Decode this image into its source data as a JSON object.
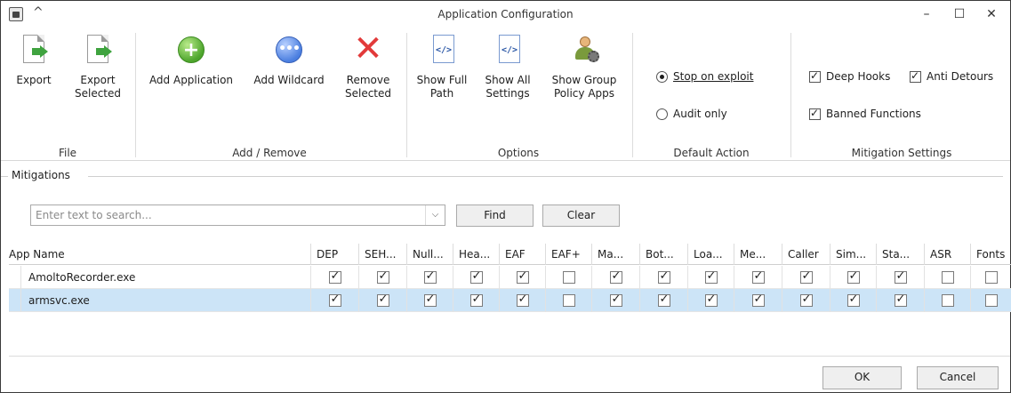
{
  "window": {
    "title": "Application Configuration",
    "collapse": "^",
    "minimize": "–",
    "maximize": "☐",
    "close": "✕"
  },
  "ribbon": {
    "file": {
      "label": "File",
      "export": "Export",
      "export_selected": "Export\nSelected"
    },
    "add_remove": {
      "label": "Add / Remove",
      "add_application": "Add Application",
      "add_wildcard": "Add Wildcard",
      "remove_selected": "Remove\nSelected"
    },
    "options": {
      "label": "Options",
      "show_full_path": "Show Full\nPath",
      "show_all_settings": "Show All\nSettings",
      "show_group_policy_apps": "Show Group\nPolicy Apps",
      "code_glyph": "</>"
    },
    "default_action": {
      "label": "Default Action",
      "stop_on_exploit": "Stop on exploit",
      "audit_only": "Audit only",
      "selected": "stop_on_exploit"
    },
    "mitigation_settings": {
      "label": "Mitigation Settings",
      "deep_hooks": "Deep Hooks",
      "anti_detours": "Anti Detours",
      "banned_functions": "Banned Functions",
      "deep_hooks_checked": true,
      "anti_detours_checked": true,
      "banned_functions_checked": true
    }
  },
  "mitigations": {
    "legend": "Mitigations",
    "search_placeholder": "Enter text to search...",
    "find_label": "Find",
    "clear_label": "Clear"
  },
  "grid": {
    "app_name_header": "App Name",
    "columns": [
      "DEP",
      "SEH...",
      "Null...",
      "Hea...",
      "EAF",
      "EAF+",
      "Ma...",
      "Bot...",
      "Loa...",
      "Me...",
      "Caller",
      "Sim...",
      "Sta...",
      "ASR",
      "Fonts"
    ],
    "rows": [
      {
        "name": "AmoltoRecorder.exe",
        "selected": false,
        "checks": [
          true,
          true,
          true,
          true,
          true,
          false,
          true,
          true,
          true,
          true,
          true,
          true,
          true,
          false,
          false
        ]
      },
      {
        "name": "armsvc.exe",
        "selected": true,
        "checks": [
          true,
          true,
          true,
          true,
          true,
          false,
          true,
          true,
          true,
          true,
          true,
          true,
          true,
          false,
          false
        ]
      }
    ]
  },
  "footer": {
    "ok_label": "OK",
    "cancel_label": "Cancel"
  }
}
